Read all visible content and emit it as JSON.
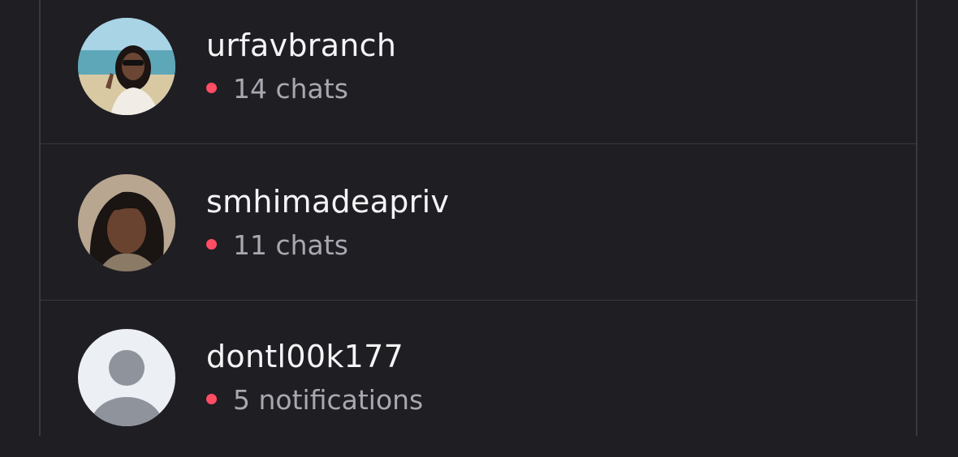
{
  "accent_dot_color": "#ff4d64",
  "accounts": [
    {
      "username": "urfavbranch",
      "status_text": "14 chats",
      "avatar": "user-photo-beach"
    },
    {
      "username": "smhimadeapriv",
      "status_text": "11 chats",
      "avatar": "user-photo-portrait"
    },
    {
      "username": "dontl00k177",
      "status_text": "5 notifications",
      "avatar": "default-avatar-icon"
    }
  ]
}
